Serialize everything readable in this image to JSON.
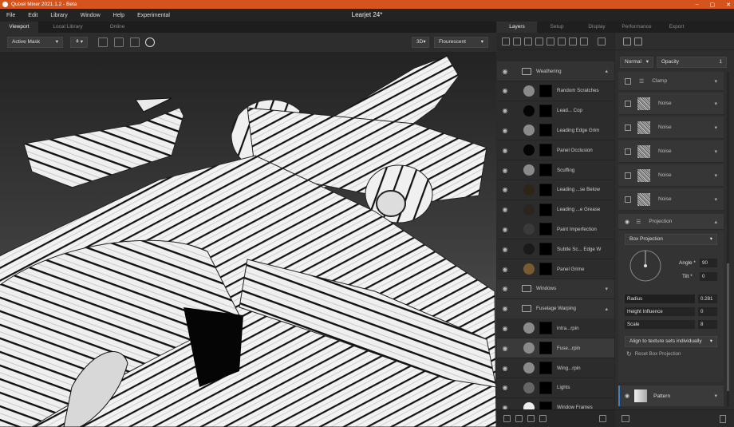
{
  "app": {
    "title": "Quixel Mixer 2021.1.2 - Beta",
    "document_title": "Learjet 24*"
  },
  "window_controls": [
    "–",
    "▢",
    "✕"
  ],
  "menu": [
    "File",
    "Edit",
    "Library",
    "Window",
    "Help",
    "Experimental"
  ],
  "viewport_tabs": [
    "Viewport",
    "Local Library",
    "Online"
  ],
  "toolbar": {
    "mask_mode": "Active Mask",
    "view_mode": "3D",
    "lighting": "Flourescent"
  },
  "right_tabs": [
    "Layers",
    "Setup",
    "Display",
    "Performance",
    "Export"
  ],
  "layers": [
    {
      "name": "Weathering",
      "type": "group"
    },
    {
      "name": "Random Scratches",
      "type": "layer",
      "swatch": "#8a8a8a"
    },
    {
      "name": "Lead... Cop",
      "type": "layer",
      "swatch": "#050505"
    },
    {
      "name": "Leading Edge Grim",
      "type": "layer",
      "swatch": "#8a8a8a"
    },
    {
      "name": "Panel Occlusion",
      "type": "layer",
      "swatch": "#050505"
    },
    {
      "name": "Scuffing",
      "type": "layer",
      "swatch": "#8a8a8a"
    },
    {
      "name": "Leading ...se Below",
      "type": "layer",
      "swatch": "#2e2418"
    },
    {
      "name": "Leading ...e Grease",
      "type": "layer",
      "swatch": "#2a2520"
    },
    {
      "name": "Paint Imperfection",
      "type": "layer",
      "swatch": "#3a3a3a"
    },
    {
      "name": "Subtle Sc... Edge W",
      "type": "layer",
      "swatch": "#1a1a1a"
    },
    {
      "name": "Panel Grime",
      "type": "layer",
      "swatch": "#7a5a30"
    },
    {
      "name": "Windows",
      "type": "group"
    },
    {
      "name": "Fuselage Warping",
      "type": "group"
    },
    {
      "name": "intra...rpin",
      "type": "layer",
      "swatch": "#8a8a8a"
    },
    {
      "name": "Fuse...rpin",
      "type": "layer",
      "swatch": "#8a8a8a"
    },
    {
      "name": "Wing...rpin",
      "type": "layer",
      "swatch": "#8a8a8a"
    },
    {
      "name": "Lights",
      "type": "layer",
      "swatch": "#666666"
    },
    {
      "name": "Window Frames",
      "type": "layer",
      "swatch": "#eeeeee"
    }
  ],
  "props": {
    "blend_mode": "Normal",
    "opacity_label": "Opacity",
    "opacity_value": "1",
    "stack": [
      {
        "name": "Clamp",
        "kind": "clamp"
      },
      {
        "name": "Noise",
        "kind": "noise"
      },
      {
        "name": "Noise",
        "kind": "noise"
      },
      {
        "name": "Noise",
        "kind": "noise"
      },
      {
        "name": "Noise",
        "kind": "noise"
      },
      {
        "name": "Noise",
        "kind": "noise"
      }
    ],
    "projection": {
      "title": "Projection",
      "mode": "Box Projection",
      "angle_label": "Angle *",
      "angle": "90",
      "tilt_label": "Tilt *",
      "tilt": "0",
      "radius_label": "Radius",
      "radius": "0.281",
      "height_label": "Height Influence",
      "height": "0",
      "scale_label": "Scale",
      "scale": "8",
      "align": "Align to texture sets individually",
      "reset": "Reset Box Projection"
    },
    "pattern_label": "Pattern"
  }
}
